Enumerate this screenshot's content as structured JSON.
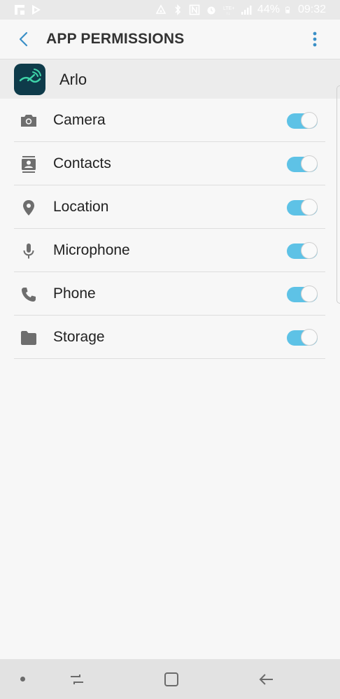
{
  "status_bar": {
    "battery": "44%",
    "time": "09:32",
    "icons": [
      "flipboard-icon",
      "play-store-icon",
      "nearby-icon",
      "bluetooth-icon",
      "nfc-icon",
      "alarm-icon",
      "lte-icon",
      "signal-icon",
      "battery-icon"
    ]
  },
  "app_bar": {
    "title": "APP PERMISSIONS",
    "back_icon": "chevron-left-icon",
    "more_icon": "more-vertical-icon"
  },
  "app": {
    "name": "Arlo",
    "icon": "arlo-logo-icon"
  },
  "permissions": [
    {
      "label": "Camera",
      "icon": "camera-icon",
      "enabled": true
    },
    {
      "label": "Contacts",
      "icon": "contacts-icon",
      "enabled": true
    },
    {
      "label": "Location",
      "icon": "location-pin-icon",
      "enabled": true
    },
    {
      "label": "Microphone",
      "icon": "microphone-icon",
      "enabled": true
    },
    {
      "label": "Phone",
      "icon": "phone-icon",
      "enabled": true
    },
    {
      "label": "Storage",
      "icon": "folder-icon",
      "enabled": true
    }
  ],
  "colors": {
    "accent": "#5ec2e6",
    "back_arrow": "#3a8fc7",
    "icon_gray": "#6e6e6e"
  }
}
